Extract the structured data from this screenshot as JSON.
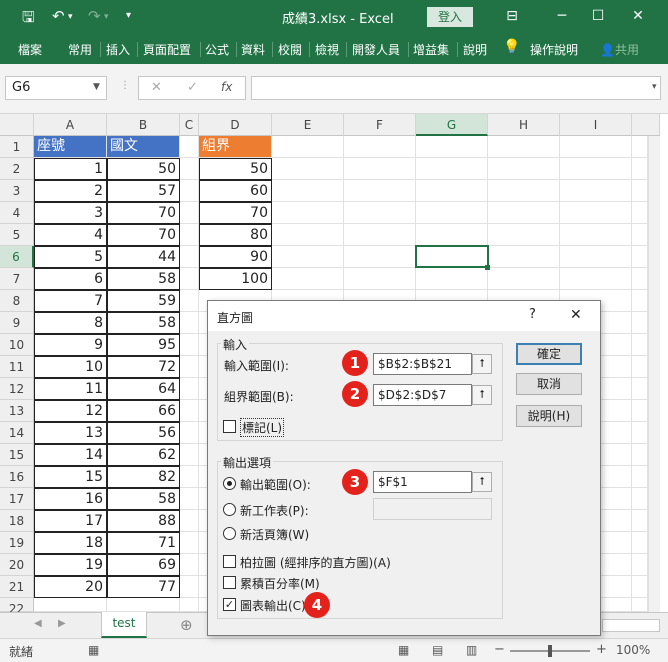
{
  "window": {
    "title": "成績3.xlsx  -  Excel",
    "login_label": "登入",
    "minimize_icon": "─",
    "restore_icon": "☐",
    "close_icon": "✕",
    "ribbon_display_icon": "⊟"
  },
  "ribbon": {
    "tabs": [
      "檔案",
      "常用",
      "插入",
      "頁面配置",
      "公式",
      "資料",
      "校閱",
      "檢視",
      "開發人員",
      "增益集",
      "說明"
    ],
    "tell_me": "操作說明",
    "share": "共用"
  },
  "formula_bar": {
    "name_box": "G6",
    "formula": ""
  },
  "grid": {
    "columns": [
      "A",
      "B",
      "C",
      "D",
      "E",
      "F",
      "G",
      "H",
      "I"
    ],
    "rows": [
      "1",
      "2",
      "3",
      "4",
      "5",
      "6",
      "7",
      "8",
      "9",
      "10",
      "11",
      "12",
      "13",
      "14",
      "15",
      "16",
      "17",
      "18",
      "19",
      "20",
      "21",
      "22"
    ],
    "header_A": "座號",
    "header_B": "國文",
    "header_D": "組界",
    "col_A": [
      "1",
      "2",
      "3",
      "4",
      "5",
      "6",
      "7",
      "8",
      "9",
      "10",
      "11",
      "12",
      "13",
      "14",
      "15",
      "16",
      "17",
      "18",
      "19",
      "20"
    ],
    "col_B": [
      "50",
      "57",
      "70",
      "70",
      "44",
      "58",
      "59",
      "58",
      "95",
      "72",
      "64",
      "66",
      "56",
      "62",
      "82",
      "58",
      "88",
      "71",
      "69",
      "77"
    ],
    "col_D": [
      "50",
      "60",
      "70",
      "80",
      "90",
      "100"
    ],
    "header_colors": {
      "blue": "#4472c4",
      "orange": "#ed7d31"
    }
  },
  "sheet": {
    "tab_name": "test",
    "status": "就緒",
    "zoom": "100%"
  },
  "dialog": {
    "title": "直方圖",
    "help_icon": "?",
    "close_icon": "✕",
    "input_group": "輸入",
    "input_range_label": "輸入範圍(I):",
    "input_range_value": "$B$2:$B$21",
    "bin_range_label": "組界範圍(B):",
    "bin_range_value": "$D$2:$D$7",
    "labels_checkbox": "標記(L)",
    "output_group": "輸出選項",
    "output_range_label": "輸出範圍(O):",
    "output_range_value": "$F$1",
    "new_worksheet_label": "新工作表(P):",
    "new_workbook_label": "新活頁簿(W)",
    "pareto_label": "柏拉圖 (經排序的直方圖)(A)",
    "cumulative_label": "累積百分率(M)",
    "chart_output_label": "圖表輸出(C)",
    "ok_button": "確定",
    "cancel_button": "取消",
    "help_button": "說明(H)",
    "badges": [
      "1",
      "2",
      "3",
      "4"
    ]
  }
}
